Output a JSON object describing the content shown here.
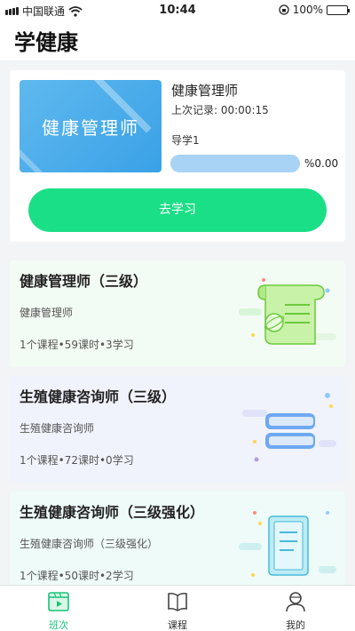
{
  "status_bar": {
    "carrier": "中国联通",
    "time": "10:44",
    "battery": "100%"
  },
  "header": {
    "title": "学健康"
  },
  "study_card": {
    "cover_title": "健康管理师",
    "course_name": "健康管理师",
    "last_record": "上次记录: 00:00:15",
    "lesson": "导学1",
    "progress_text": "%0.00",
    "progress_value": 0,
    "button_label": "去学习"
  },
  "categories": [
    {
      "title": "健康管理师（三级）",
      "subtitle": "健康管理师",
      "stats": "1个课程•59课时•3学习"
    },
    {
      "title": "生殖健康咨询师（三级）",
      "subtitle": "生殖健康咨询师",
      "stats": "1个课程•72课时•0学习"
    },
    {
      "title": "生殖健康咨询师（三级强化）",
      "subtitle": "生殖健康咨询师（三级强化）",
      "stats": "1个课程•50课时•2学习"
    }
  ],
  "tabs": [
    {
      "label": "班次",
      "icon": "video-icon",
      "active": true
    },
    {
      "label": "课程",
      "icon": "book-icon",
      "active": false
    },
    {
      "label": "我的",
      "icon": "user-icon",
      "active": false
    }
  ],
  "colors": {
    "accent": "#1bdf86",
    "progress": "#3aa1e7",
    "tab_active": "#19c37a"
  }
}
